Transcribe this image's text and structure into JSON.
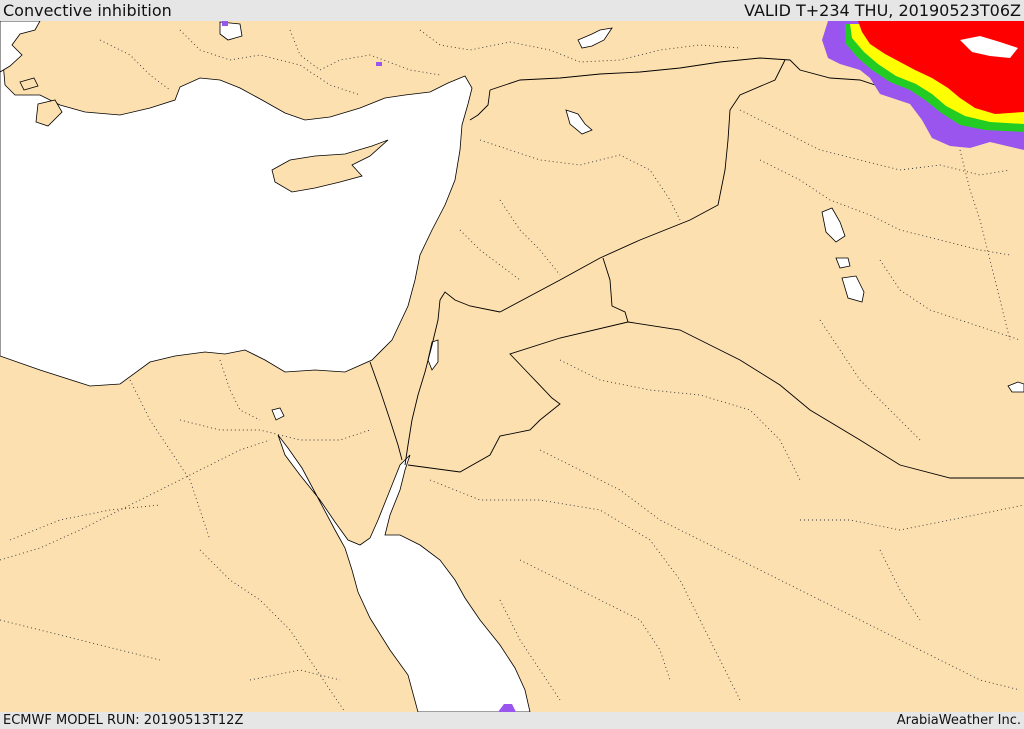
{
  "header": {
    "title": "Convective inhibition",
    "valid_label": "VALID T+234 THU, 20190523T06Z"
  },
  "footer": {
    "model_run_label": "ECMWF MODEL RUN: 20190513T12Z",
    "credit": "ArabiaWeather Inc."
  },
  "map": {
    "land_color": "#fde0b0",
    "sea_color": "#ffffff",
    "border_color": "#000000",
    "cin_colors": [
      "#9955ee",
      "#ff0000",
      "#ffff00",
      "#22cc22",
      "#ffffff"
    ]
  }
}
